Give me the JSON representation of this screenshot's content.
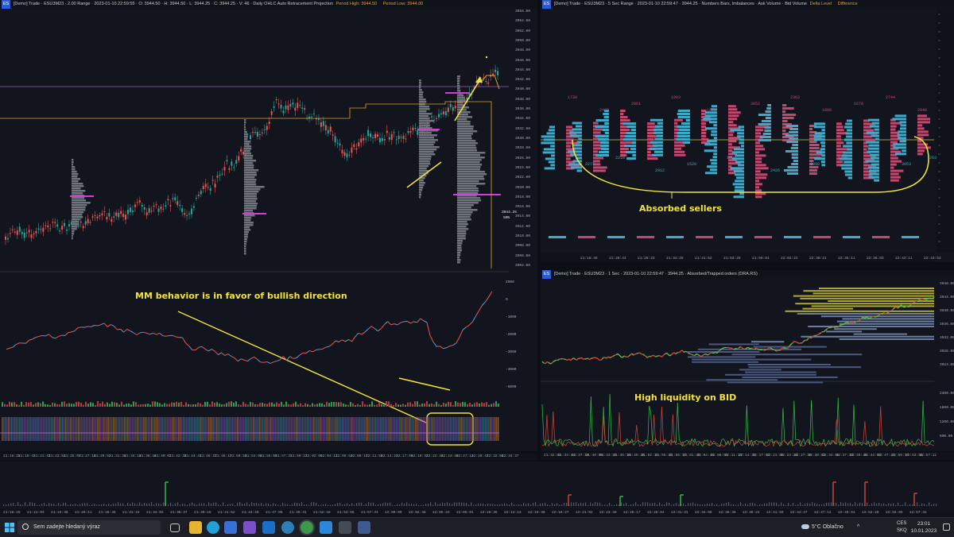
{
  "left_chart": {
    "header": "[Demo] Trade · ESU3M23 · 2.00 Range · 2023-01-10 22:59:55 · O: 3944.50 · H: 3944.50 · L: 3944.25 · C: 3944.25 · V: 46 · Daily OHLC  Auto Retracement Projection",
    "header_tags": [
      "Period High: 3944.50",
      "Period Low: 3944.00"
    ],
    "price_ticks": [
      "3956.00",
      "3954.00",
      "3952.00",
      "3950.00",
      "3948.00",
      "3946.00",
      "3944.00",
      "3942.00",
      "3940.00",
      "3938.00",
      "3936.00",
      "3934.00",
      "3932.00",
      "3930.00",
      "3928.00",
      "3926.00",
      "3924.00",
      "3922.00",
      "3920.00",
      "3918.00",
      "3916.00",
      "3914.00",
      "3912.00",
      "3910.00",
      "3908.00",
      "3906.00",
      "3904.00"
    ],
    "osc_ticks": [
      "2000",
      "0",
      "-1000",
      "-2000",
      "-3000",
      "-4000",
      "-5000"
    ],
    "side_label_value": "3944.25",
    "side_label_pct": "50%",
    "time_ticks": [
      "21:18:25",
      "21:19:42",
      "21:21:41",
      "21:22:53",
      "21:25:07",
      "21:27:18",
      "21:29:52",
      "21:31:36",
      "21:34:10",
      "21:36:48",
      "21:40:02",
      "21:42:38",
      "21:44:41",
      "21:46:37",
      "21:48:17",
      "21:50:59",
      "21:53:08",
      "21:55:09",
      "21:57:32",
      "21:59:27",
      "22:02:09",
      "22:04:11",
      "22:06:53",
      "22:09:17",
      "22:11:58",
      "22:14:21",
      "22:17:06",
      "22:19:32",
      "22:22:45",
      "22:24:40",
      "22:27:13",
      "22:29:47",
      "22:32:04",
      "22:34:37"
    ]
  },
  "right_top": {
    "header": "[Demo] Trade · ESU3M23 · 5 Sec Range · 2023-01-10 22:59:47 · 3944.25 · Numbers Bars, Imbalances · Ask Volume · Bid Volume",
    "header_tags": [
      "Delta Level",
      "Difference"
    ],
    "time_ticks": [
      "21:18:48",
      "21:26:43",
      "21:28:22",
      "21:34:28",
      "21:41:52",
      "21:53:28",
      "21:59:51",
      "22:02:21",
      "22:30:21",
      "22:35:11",
      "22:36:03",
      "22:42:11",
      "22:43:53"
    ],
    "cluster_numbers": [
      "1739",
      "2273",
      "2427",
      "2218",
      "2861",
      "2912",
      "1903",
      "1520",
      "1993",
      "1283",
      "3052",
      "2426",
      "2363",
      "1908",
      "1896",
      "1408",
      "1678",
      "1498",
      "2744",
      "3053",
      "2040",
      "2039",
      "2163",
      "2869"
    ]
  },
  "right_bottom": {
    "header": "[Demo] Trade · ESU3M23 · 1 Sec · 2023-01-10 22:59:47 · 3944.25 · Absorbed/Trapped orders (DRA.RS)",
    "price_ticks": [
      "3948.00",
      "3944.00",
      "3940.00",
      "3936.00",
      "3932.00",
      "3928.00",
      "3924.00"
    ],
    "vol_ticks": [
      "2400.00",
      "1800.00",
      "1200.00",
      "600.00"
    ],
    "time_ticks": [
      "21:32:01",
      "21:34:44",
      "21:37:18",
      "21:40:09",
      "21:43:21",
      "21:46:10",
      "21:49:38",
      "21:52:11",
      "21:55:32",
      "21:58:17",
      "22:01:36",
      "22:04:45",
      "22:08:01",
      "22:11:13",
      "22:14:31",
      "22:17:52",
      "22:21:05",
      "22:24:26",
      "22:27:39",
      "22:30:52",
      "22:34:08",
      "22:37:33",
      "22:40:49",
      "22:44:02",
      "22:47:21",
      "22:50:37",
      "22:53:56",
      "22:57:11"
    ]
  },
  "bottom_strip": {
    "time_ticks": [
      "21:18:25",
      "21:21:03",
      "21:23:38",
      "21:26:11",
      "21:28:46",
      "21:31:24",
      "21:34:02",
      "21:36:37",
      "21:39:15",
      "21:41:52",
      "21:44:29",
      "21:47:06",
      "21:49:41",
      "21:52:18",
      "21:54:55",
      "21:57:33",
      "22:00:09",
      "22:02:46",
      "22:05:23",
      "22:08:01",
      "22:10:36",
      "22:13:13",
      "22:15:49",
      "22:18:27",
      "22:21:02",
      "22:23:39",
      "22:26:17",
      "22:28:54",
      "22:31:31",
      "22:34:08",
      "22:36:45",
      "22:39:22",
      "22:41:59",
      "22:44:37",
      "22:47:14",
      "22:49:51",
      "22:52:28",
      "22:55:05",
      "22:57:42"
    ]
  },
  "annotations": {
    "mm_behavior": "MM behavior is in favor of bullish direction",
    "absorbed_sellers": "Absorbed sellers",
    "high_liquidity": "High liquidity on BID"
  },
  "taskbar": {
    "search_placeholder": "Sem zadejte hledaný výraz",
    "weather": "5°C  Oblačno",
    "language_top": "CES",
    "language_bottom": "SKQ",
    "time": "23:01",
    "date": "10.01.2023"
  },
  "colors": {
    "annotation": "#f2e23a",
    "bull": "#26a69a",
    "bear": "#ef5350",
    "magenta": "#d63bd6",
    "purple_line": "#9b59d0",
    "orange_line": "#e0a030"
  }
}
